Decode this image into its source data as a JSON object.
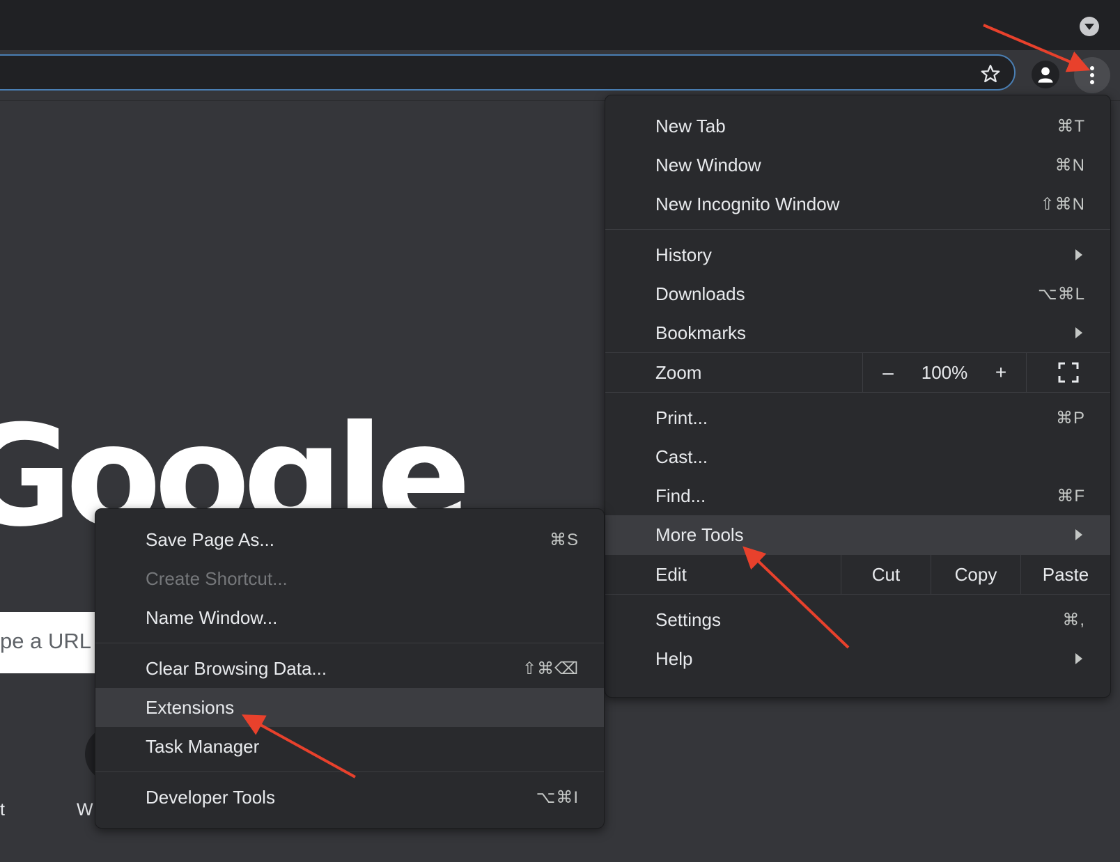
{
  "browser": {
    "tab_dropdown_icon": "chevron-down-icon",
    "star_icon": "star-icon",
    "profile_icon": "person-icon",
    "menu_icon": "three-dots-vertical-icon"
  },
  "page": {
    "logo_text": "Google",
    "search_placeholder_fragment": "pe a URL",
    "shortcut_label_left": "t",
    "shortcut_label_mid": "W"
  },
  "main_menu": {
    "new_tab": {
      "label": "New Tab",
      "shortcut": "⌘T"
    },
    "new_window": {
      "label": "New Window",
      "shortcut": "⌘N"
    },
    "new_incognito": {
      "label": "New Incognito Window",
      "shortcut": "⇧⌘N"
    },
    "history": {
      "label": "History"
    },
    "downloads": {
      "label": "Downloads",
      "shortcut": "⌥⌘L"
    },
    "bookmarks": {
      "label": "Bookmarks"
    },
    "zoom": {
      "label": "Zoom",
      "minus": "–",
      "value": "100%",
      "plus": "+"
    },
    "print": {
      "label": "Print...",
      "shortcut": "⌘P"
    },
    "cast": {
      "label": "Cast..."
    },
    "find": {
      "label": "Find...",
      "shortcut": "⌘F"
    },
    "more_tools": {
      "label": "More Tools"
    },
    "edit": {
      "label": "Edit",
      "cut": "Cut",
      "copy": "Copy",
      "paste": "Paste"
    },
    "settings": {
      "label": "Settings",
      "shortcut": "⌘,"
    },
    "help": {
      "label": "Help"
    }
  },
  "more_tools_menu": {
    "save_page": {
      "label": "Save Page As...",
      "shortcut": "⌘S"
    },
    "create_shortcut": {
      "label": "Create Shortcut..."
    },
    "name_window": {
      "label": "Name Window..."
    },
    "clear_data": {
      "label": "Clear Browsing Data...",
      "shortcut": "⇧⌘⌫"
    },
    "extensions": {
      "label": "Extensions"
    },
    "task_manager": {
      "label": "Task Manager"
    },
    "developer_tools": {
      "label": "Developer Tools",
      "shortcut": "⌥⌘I"
    }
  },
  "colors": {
    "annotation_arrow": "#e8412c",
    "menu_bg": "#292a2d",
    "highlight": "#3c3d41",
    "omnibox_border": "#4a7fb4"
  }
}
